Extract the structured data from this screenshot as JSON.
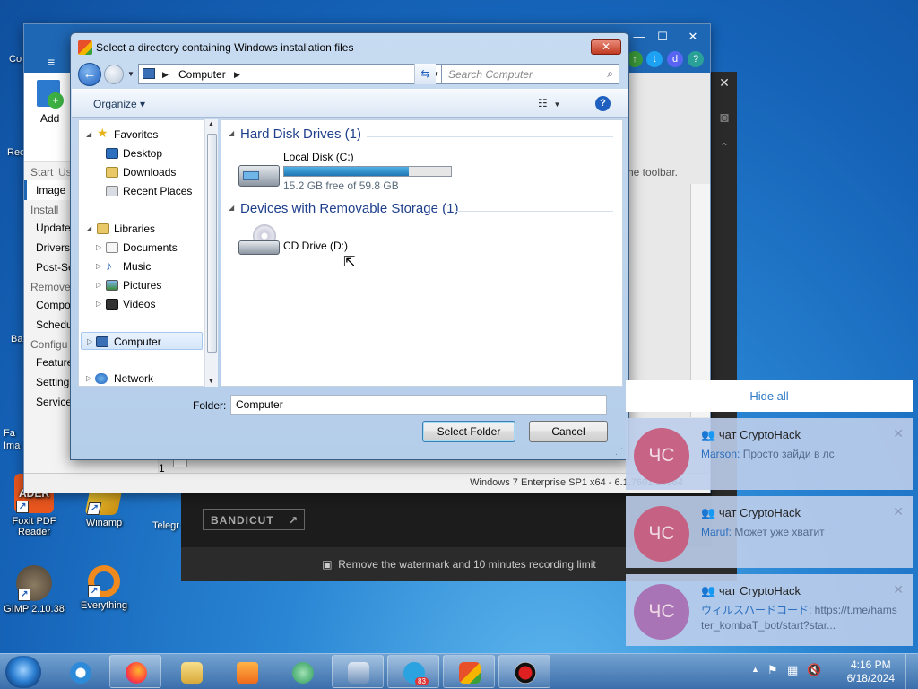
{
  "desktop": {
    "icons": [
      {
        "label": "Foxit PDF Reader",
        "color": "#e8561e",
        "glyph": "ADER"
      },
      {
        "label": "Winamp",
        "color": "#f0c020",
        "glyph": ""
      },
      {
        "label": "GIMP 2.10.38",
        "color": "#7a6a55",
        "glyph": ""
      },
      {
        "label": "Everything",
        "color": "#f08a1c",
        "glyph": ""
      }
    ],
    "edge_labels": [
      "Co",
      "Rec",
      "Ba",
      "Fa Ima",
      "Telegr"
    ]
  },
  "app_window": {
    "add_label": "Add",
    "hint_left": "Us",
    "hint_right": "he toolbar.",
    "sections": [
      {
        "title": "Start",
        "items": [
          "Image"
        ]
      },
      {
        "title": "Install",
        "items": [
          "Update",
          "Drivers",
          "Post-Se"
        ]
      },
      {
        "title": "Remove",
        "items": [
          "Compo",
          "Schedu"
        ]
      },
      {
        "title": "Configu",
        "items": [
          "Feature",
          "Setting",
          "Services"
        ]
      }
    ],
    "services_count": "1",
    "status": "Windows 7 Enterprise SP1 x64 - 6.1.7601.23864"
  },
  "bandicut": {
    "logo": "BANDICUT",
    "watermark": "Remove the watermark and 10 minutes recording limit"
  },
  "dialog": {
    "title": "Select a directory containing Windows installation files",
    "close": "✕",
    "address": {
      "path": "Computer"
    },
    "search_placeholder": "Search Computer",
    "toolbar": {
      "organize": "Organize ▾"
    },
    "tree": {
      "favorites": {
        "label": "Favorites",
        "items": [
          "Desktop",
          "Downloads",
          "Recent Places"
        ]
      },
      "libraries": {
        "label": "Libraries",
        "items": [
          "Documents",
          "Music",
          "Pictures",
          "Videos"
        ]
      },
      "computer": "Computer",
      "network": "Network"
    },
    "groups": {
      "hdd": "Hard Disk Drives (1)",
      "removable": "Devices with Removable Storage (1)"
    },
    "drives": {
      "c": {
        "name": "Local Disk (C:)",
        "free": "15.2 GB free of 59.8 GB",
        "used_fraction": 0.746
      },
      "d": {
        "name": "CD Drive (D:)"
      }
    },
    "folder_label": "Folder:",
    "folder_value": "Computer",
    "select_button": "Select Folder",
    "cancel_button": "Cancel"
  },
  "notifications": {
    "hide_all": "Hide all",
    "items": [
      {
        "avatar": "ЧС",
        "title": "чат CryptoHack",
        "sender": "Marson:",
        "text": " Просто зайди в лс"
      },
      {
        "avatar": "ЧС",
        "title": "чат CryptoHack",
        "sender": "Maruf:",
        "text": " Может уже хватит"
      },
      {
        "avatar": "ЧС",
        "title": "чат CryptoHack",
        "sender": "ウィルスハードコード:",
        "text": " https://t.me/hamster_kombaT_bot/start?star..."
      }
    ]
  },
  "taskbar": {
    "telegram_badge": "83",
    "time": "4:16 PM",
    "date": "6/18/2024"
  }
}
